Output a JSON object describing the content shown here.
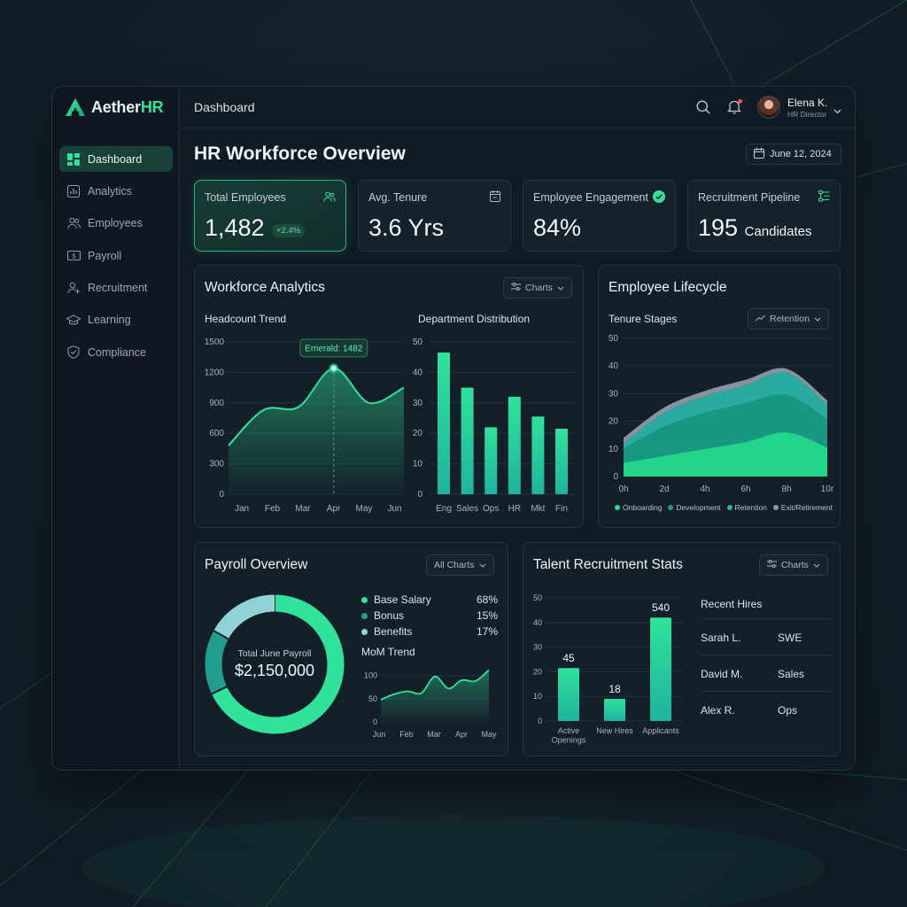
{
  "app": {
    "brand_main": "Aether",
    "brand_accent": "HR",
    "accent_color": "#2fe39a"
  },
  "sidebar": {
    "items": [
      {
        "label": "Dashboard",
        "icon": "grid-icon",
        "active": true
      },
      {
        "label": "Analytics",
        "icon": "bar-chart-icon"
      },
      {
        "label": "Employees",
        "icon": "people-icon"
      },
      {
        "label": "Payroll",
        "icon": "money-icon"
      },
      {
        "label": "Recruitment",
        "icon": "user-add-icon"
      },
      {
        "label": "Learning",
        "icon": "graduation-cap-icon"
      },
      {
        "label": "Compliance",
        "icon": "shield-check-icon"
      }
    ]
  },
  "topbar": {
    "breadcrumb": "Dashboard",
    "user_name": "Elena K.",
    "user_role": "HR Director",
    "has_notification": true
  },
  "page": {
    "title": "HR Workforce Overview",
    "date": "June 12, 2024"
  },
  "kpis": [
    {
      "label": "Total Employees",
      "value": "1,482",
      "delta": "+2.4%",
      "icon": "people-icon"
    },
    {
      "label": "Avg. Tenure",
      "value": "3.6 Yrs",
      "icon": "calendar-icon"
    },
    {
      "label": "Employee Engagement",
      "value": "84%",
      "icon": "check-circle-icon"
    },
    {
      "label": "Recruitment Pipeline",
      "value": "195",
      "unit": "Candidates",
      "icon": "flow-icon"
    }
  ],
  "workforce": {
    "title": "Workforce Analytics",
    "filter_label": "Charts",
    "headcount_title": "Headcount Trend",
    "dept_title": "Department Distribution",
    "tooltip": "Emerald: 1482"
  },
  "lifecycle": {
    "title": "Employee Lifecycle",
    "sub_title": "Tenure Stages",
    "filter_label": "Retention"
  },
  "payroll": {
    "title": "Payroll Overview",
    "filter_label": "All Charts",
    "center_label": "Total June Payroll",
    "center_value": "$2,150,000",
    "mom_title": "MoM Trend"
  },
  "recruit": {
    "title": "Talent Recruitment Stats",
    "filter_label": "Charts",
    "recent_title": "Recent Hires",
    "hires": [
      {
        "name": "Sarah L.",
        "role": "SWE"
      },
      {
        "name": "David M.",
        "role": "Sales"
      },
      {
        "name": "Alex R.",
        "role": "Ops"
      }
    ]
  },
  "chart_data": [
    {
      "id": "headcount",
      "type": "area",
      "title": "Headcount Trend",
      "categories": [
        "Jan",
        "Feb",
        "Mar",
        "Apr",
        "May",
        "Jun"
      ],
      "values": [
        480,
        830,
        860,
        1240,
        900,
        1050
      ],
      "yticks": [
        0,
        300,
        600,
        900,
        1200,
        1500
      ],
      "ylim": [
        0,
        1500
      ],
      "highlight": {
        "category": "Apr",
        "value": 1240
      }
    },
    {
      "id": "department",
      "type": "bar",
      "title": "Department Distribution",
      "categories": [
        "Eng",
        "Sales",
        "Ops",
        "HR",
        "Mkt",
        "Fin"
      ],
      "values": [
        46.5,
        35,
        22,
        32,
        25.5,
        21.5
      ],
      "yticks": [
        0,
        10,
        20,
        30,
        40,
        50
      ],
      "ylim": [
        0,
        50
      ]
    },
    {
      "id": "lifecycle",
      "type": "area",
      "title": "Tenure Stages",
      "x": [
        "0h",
        "2d",
        "4h",
        "6h",
        "8h",
        "10r"
      ],
      "yticks": [
        0,
        10,
        20,
        30,
        40,
        50
      ],
      "ylim": [
        0,
        50
      ],
      "stacked": true,
      "series": [
        {
          "name": "Onboarding",
          "color": "#22e08f",
          "values": [
            5,
            7.5,
            10,
            12.5,
            16,
            10.5
          ]
        },
        {
          "name": "Development",
          "color": "#1a9e86",
          "values": [
            5,
            10.5,
            13,
            14,
            13.5,
            10
          ]
        },
        {
          "name": "Retention",
          "color": "#2bb3a5",
          "values": [
            2,
            5,
            6,
            6.5,
            8,
            5.5
          ]
        },
        {
          "name": "Exit/Retirement",
          "color": "#8a9aa3",
          "values": [
            2,
            2,
            2,
            2,
            1.5,
            1.5
          ]
        }
      ]
    },
    {
      "id": "payroll_split",
      "type": "pie",
      "series": [
        {
          "name": "Base Salary",
          "value": 68,
          "label": "68%",
          "color": "#2fe39a"
        },
        {
          "name": "Bonus",
          "value": 15,
          "label": "15%",
          "color": "#1f9e8f"
        },
        {
          "name": "Benefits",
          "value": 17,
          "label": "17%",
          "color": "#8fd3d6"
        }
      ]
    },
    {
      "id": "mom",
      "type": "area",
      "title": "MoM Trend",
      "categories": [
        "Jun",
        "Feb",
        "Mar",
        "Apr",
        "May"
      ],
      "x_points": [
        0,
        0.5,
        1,
        1.5,
        2,
        2.5,
        3,
        3.5,
        4
      ],
      "values": [
        48,
        60,
        66,
        62,
        98,
        72,
        90,
        88,
        112
      ],
      "yticks": [
        0,
        50,
        100
      ],
      "ylim": [
        0,
        130
      ]
    },
    {
      "id": "recruitment",
      "type": "bar",
      "categories": [
        "Active Openings",
        "New Hires",
        "Applicants"
      ],
      "values": [
        45,
        18,
        540
      ],
      "bar_levels": [
        21.5,
        9,
        42
      ],
      "yticks": [
        0,
        10,
        20,
        30,
        40,
        50
      ],
      "ylim": [
        0,
        50
      ],
      "data_labels": [
        "45",
        "18",
        "540"
      ]
    }
  ]
}
